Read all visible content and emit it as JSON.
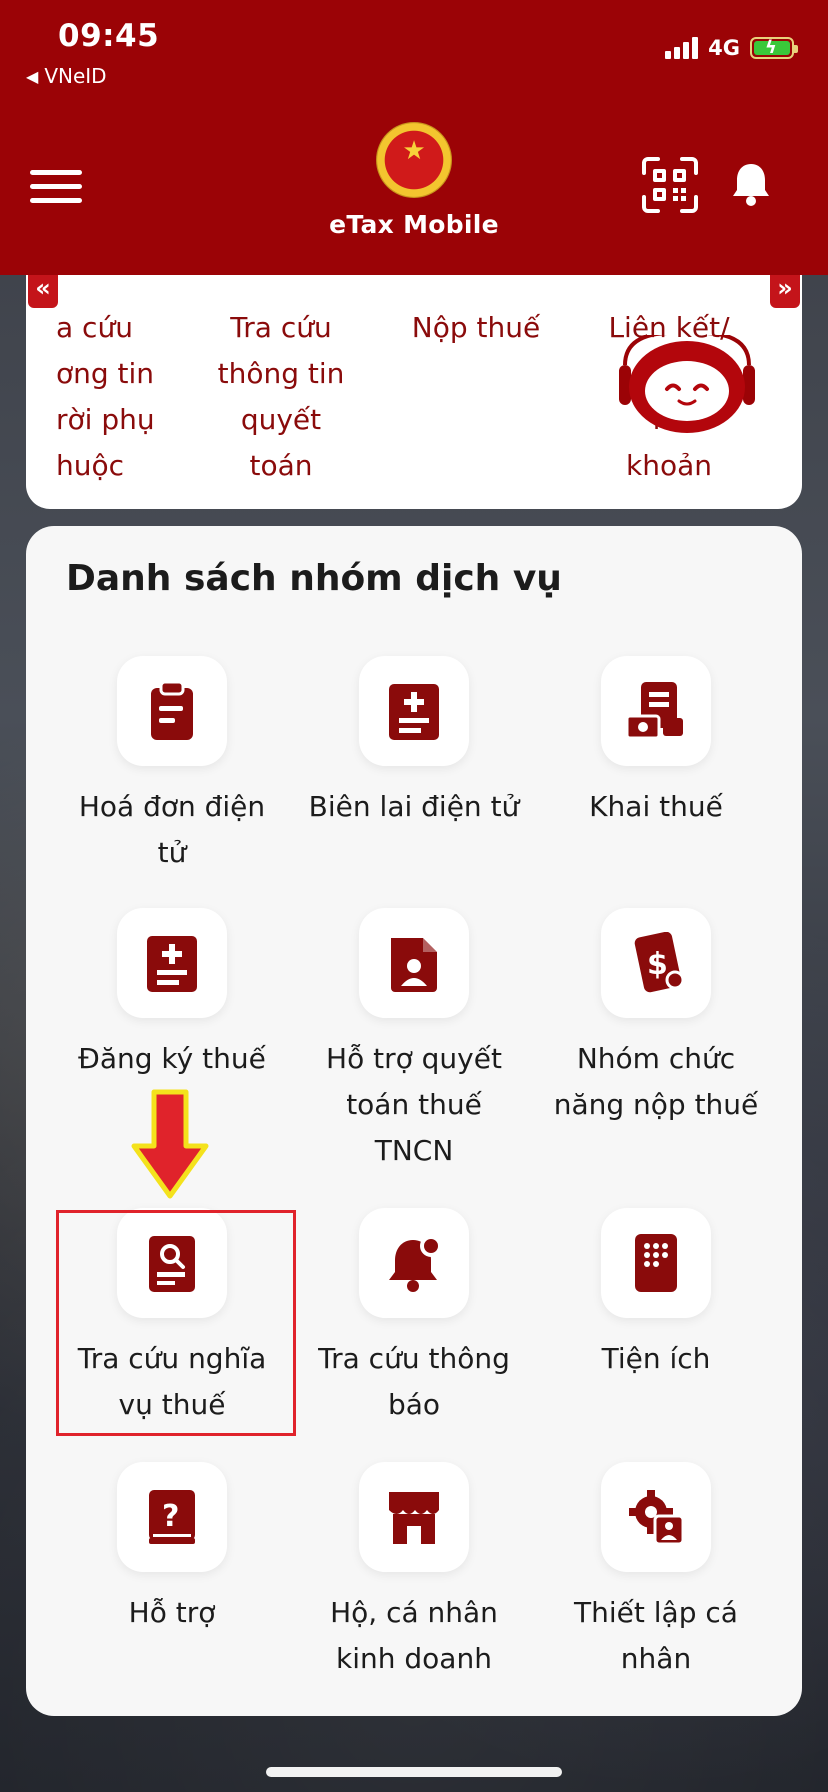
{
  "status_bar": {
    "time": "09:45",
    "back_app": "VNeID",
    "network": "4G"
  },
  "header": {
    "app_title": "eTax Mobile"
  },
  "quick_services": [
    {
      "label": "a cứu\nơng tin\nrời phụ\nhuộc"
    },
    {
      "label": "Tra cứu\nthông tin\nquyết\ntoán"
    },
    {
      "label": "Nộp thuế"
    },
    {
      "label": "Liên kết/\nH\nke\nkhoản"
    }
  ],
  "arrows": {
    "left": "«",
    "right": "»"
  },
  "services": {
    "title": "Danh sách nhóm dịch vụ",
    "items": [
      {
        "label": "Hoá đơn điện\ntử",
        "icon": "clipboard-icon"
      },
      {
        "label": "Biên lai điện tử",
        "icon": "receipt-plus-icon"
      },
      {
        "label": "Khai thuế",
        "icon": "document-money-icon"
      },
      {
        "label": "Đăng ký thuế",
        "icon": "register-plus-icon"
      },
      {
        "label": "Hỗ trợ quyết\ntoán thuế\nTNCN",
        "icon": "person-document-icon"
      },
      {
        "label": "Nhóm chức\nnăng nộp thuế",
        "icon": "payment-card-icon"
      },
      {
        "label": "Tra cứu nghĩa\nvụ thuế",
        "icon": "document-search-icon"
      },
      {
        "label": "Tra cứu thông\nbáo",
        "icon": "bell-notification-icon"
      },
      {
        "label": "Tiện ích",
        "icon": "keypad-icon"
      },
      {
        "label": "Hỗ trợ",
        "icon": "help-book-icon"
      },
      {
        "label": "Hộ, cá nhân\nkinh doanh",
        "icon": "storefront-icon"
      },
      {
        "label": "Thiết lập cá\nnhân",
        "icon": "settings-person-icon"
      }
    ]
  },
  "colors": {
    "brand": "#9b0306",
    "accent_red": "#e0232b",
    "arrow_yellow": "#f4e21c"
  }
}
